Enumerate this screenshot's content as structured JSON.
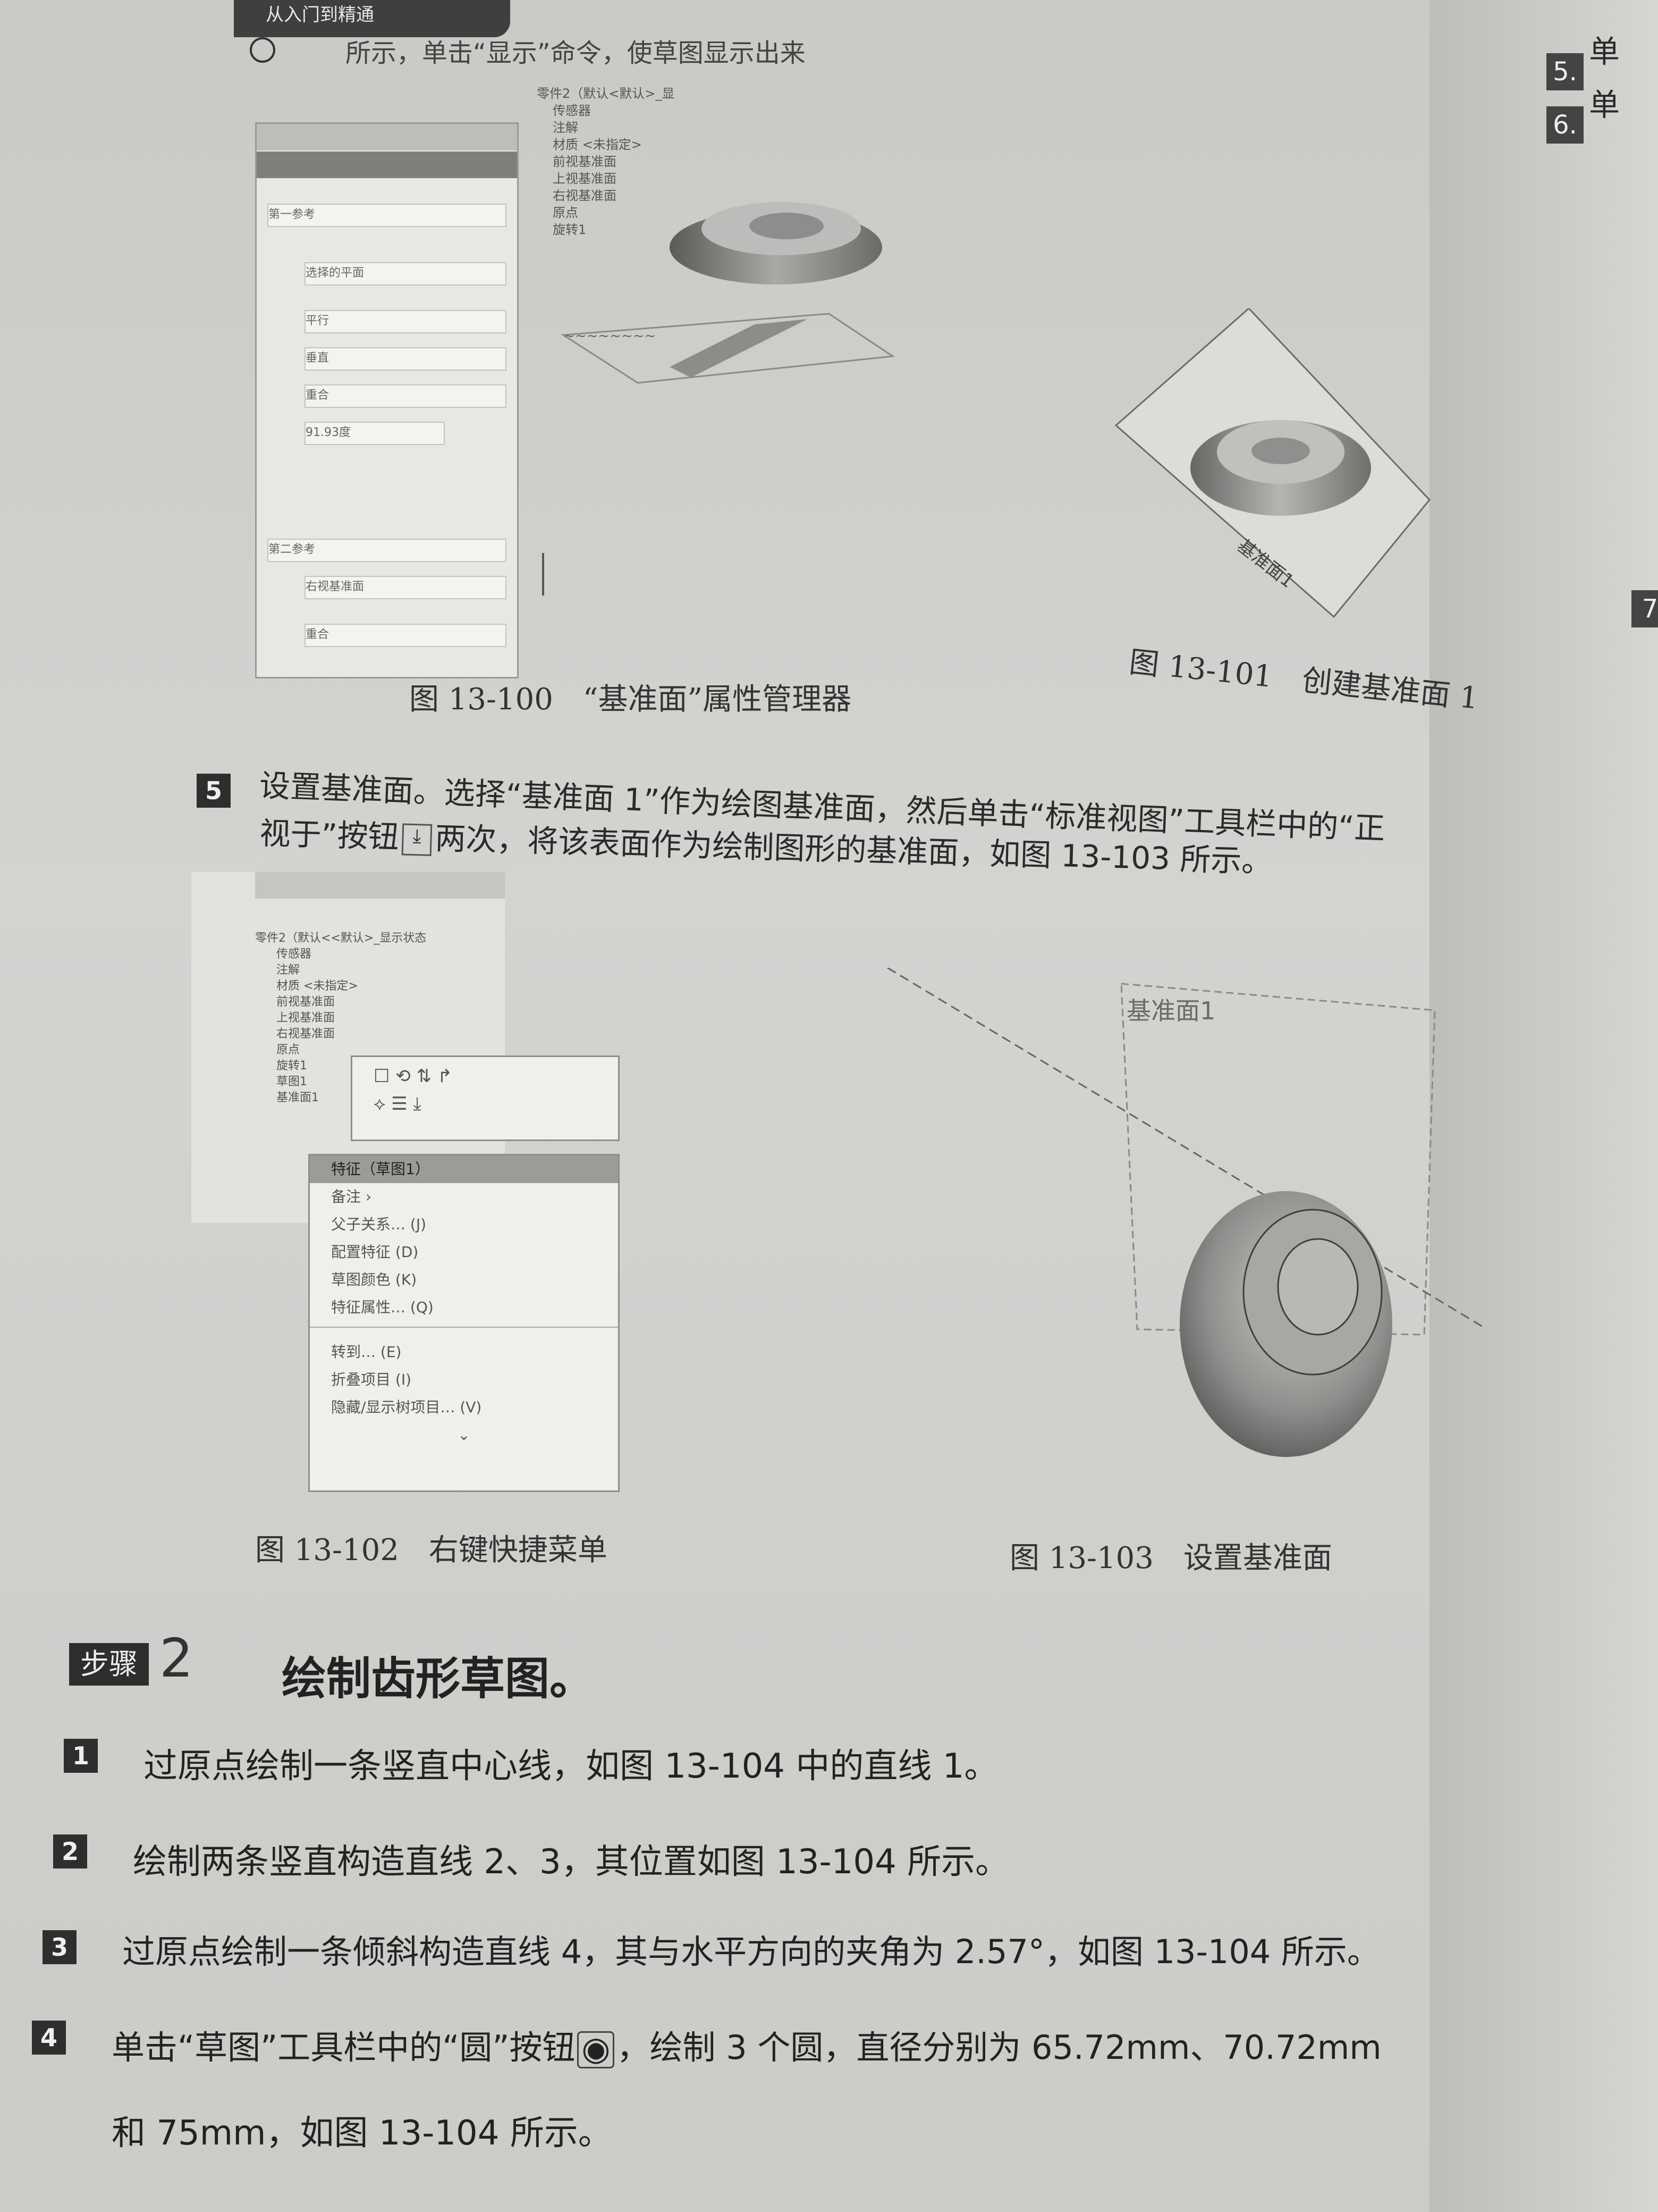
{
  "header": {
    "tab_label": "从入门到精通",
    "top_line": "所示，单击“显示”命令，使草图显示出来"
  },
  "fig100": {
    "tree_root": "零件2（默认<默认>_显",
    "tree_items": [
      "传感器",
      "注解",
      "材质 <未指定>",
      "前视基准面",
      "上视基准面",
      "右视基准面",
      "原点",
      "旋转1"
    ],
    "panel_rows": [
      "第一参考",
      "选择的平面",
      "平行",
      "垂直",
      "重合",
      "91.93度",
      "第二参考",
      "右视基准面",
      "重合"
    ],
    "caption": "图 13-100　“基准面”属性管理器"
  },
  "fig101": {
    "plane_label": "基准面1",
    "caption": "图 13-101　创建基准面 1"
  },
  "step5": {
    "number": "5",
    "line1": "设置基准面。选择“基准面 1”作为绘图基准面，然后单击“标准视图”工具栏中的“正",
    "line2_a": "视于”按钮",
    "line2_b": "两次，将该表面作为绘制图形的基准面，如图 13-103 所示。"
  },
  "fig102": {
    "tree_root": "零件2（默认<<默认>_显示状态",
    "tree_items": [
      "传感器",
      "注解",
      "材质 <未指定>",
      "前视基准面",
      "上视基准面",
      "右视基准面",
      "原点",
      "旋转1",
      "草图1",
      "基准面1"
    ],
    "menu_title": "特征（草图1）",
    "menu_items": [
      "备注",
      "父子关系…",
      "配置特征",
      "草图颜色",
      "特征属性…",
      "转到…",
      "折叠项目",
      "隐藏/显示树项目…"
    ],
    "menu_shortcuts": [
      "",
      "(J)",
      "(D)",
      "(K)",
      "(Q)",
      "(E)",
      "(I)",
      "(V)"
    ],
    "caption": "图 13-102　右键快捷菜单"
  },
  "fig103": {
    "plane_label": "基准面1",
    "caption": "图 13-103　设置基准面"
  },
  "step2": {
    "badge": "步骤",
    "number": "2",
    "title": "绘制齿形草图。"
  },
  "instructions": [
    {
      "n": "1",
      "text": "过原点绘制一条竖直中心线，如图 13-104 中的直线 1。"
    },
    {
      "n": "2",
      "text": "绘制两条竖直构造直线 2、3，其位置如图 13-104 所示。"
    },
    {
      "n": "3",
      "text": "过原点绘制一条倾斜构造直线 4，其与水平方向的夹角为 2.57°，如图 13-104 所示。"
    },
    {
      "n": "4",
      "text": "单击“草图”工具栏中的“圆”按钮",
      "text_b": "，绘制 3 个圆，直径分别为 65.72mm、70.72mm",
      "text_c": "和 75mm，如图 13-104 所示。"
    }
  ],
  "right_page": {
    "items": [
      {
        "n": "5.",
        "t": "单"
      },
      {
        "n": "6.",
        "t": "单"
      }
    ],
    "n7": "7"
  },
  "icons": [
    "down-arrow-icon",
    "circle-tool-icon",
    "normal-to-icon"
  ]
}
